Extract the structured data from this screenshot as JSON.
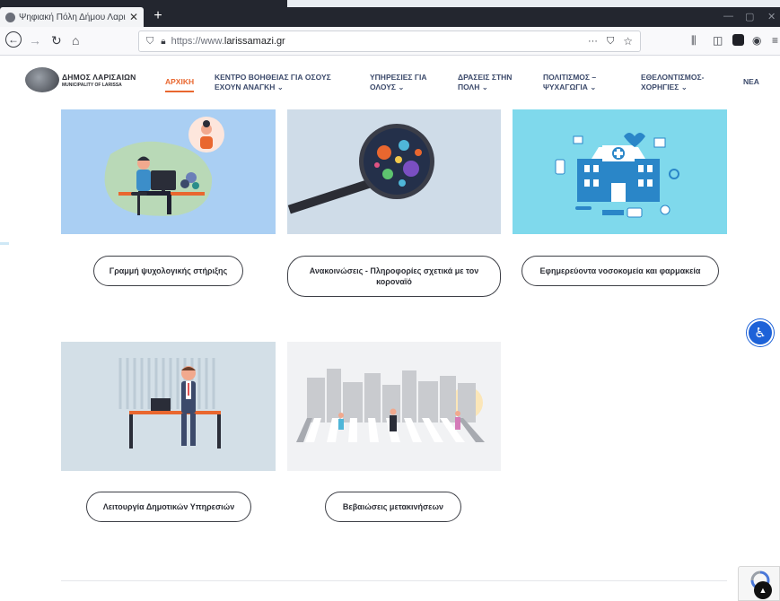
{
  "browser": {
    "tab_title": "Ψηφιακή Πόλη Δήμου Λαρισαίων",
    "tab_close": "✕",
    "new_tab": "+",
    "url_protocol": "https://www.",
    "url_host": "larissamazi.gr",
    "page_actions": "···",
    "icons": [
      "back-icon",
      "forward-icon",
      "reload-icon",
      "home-icon",
      "shield-icon",
      "lock-icon",
      "pocket-icon",
      "bookmark-star-icon",
      "library-icon",
      "sidebar-icon",
      "extension-icon",
      "account-icon",
      "menu-icon"
    ]
  },
  "site": {
    "logo": {
      "line1": "ΔΗΜΟΣ ΛΑΡΙΣΑΙΩΝ",
      "line2": "MUNICIPALITY OF LARISSA"
    },
    "menu": [
      {
        "label": "ΑΡΧΙΚΗ",
        "active": true
      },
      {
        "line1": "ΚΕΝΤΡΟ ΒΟΗΘΕΙΑΣ ΓΙΑ ΟΣΟΥΣ",
        "line2": "ΕΧΟΥΝ ΑΝΑΓΚΗ ⌄"
      },
      {
        "line1": "ΥΠΗΡΕΣΙΕΣ ΓΙΑ",
        "line2": "ΟΛΟΥΣ ⌄"
      },
      {
        "line1": "ΔΡΑΣΕΙΣ ΣΤΗΝ",
        "line2": "ΠΟΛΗ ⌄"
      },
      {
        "line1": "ΠΟΛΙΤΙΣΜΟΣ –",
        "line2": "ΨΥΧΑΓΩΓΙΑ ⌄"
      },
      {
        "line1": "ΕΘΕΛΟΝΤΙΣΜΟΣ-",
        "line2": "ΧΟΡΗΓΙΕΣ ⌄"
      },
      {
        "label": "ΝΕΑ"
      }
    ],
    "cards": [
      {
        "button": "Γραμμή ψυχολογικής στήριξης"
      },
      {
        "button_line1": "Ανακοινώσεις - Πληροφορίες σχετικά με τον",
        "button_line2": "κοροναϊό"
      },
      {
        "button": "Εφημερεύοντα νοσοκομεία και φαρμακεία"
      },
      {
        "button": "Λειτουργία Δημοτικών Υπηρεσιών"
      },
      {
        "button": "Βεβαιώσεις μετακινήσεων"
      }
    ]
  },
  "colors": {
    "accent": "#e9672f",
    "menu": "#3c4a6b",
    "chrome_dark": "#23262f",
    "accessibility": "#1d62d8"
  }
}
